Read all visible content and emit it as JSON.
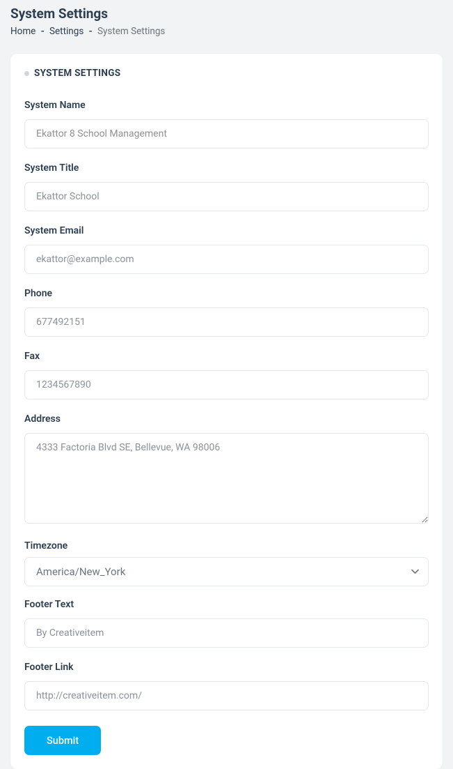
{
  "header": {
    "page_title": "System Settings",
    "breadcrumb": {
      "home": "Home",
      "settings": "Settings",
      "current": "System Settings"
    }
  },
  "card": {
    "title": "SYSTEM SETTINGS"
  },
  "form": {
    "system_name": {
      "label": "System Name",
      "value": "Ekattor 8 School Management"
    },
    "system_title": {
      "label": "System Title",
      "value": "Ekattor School"
    },
    "system_email": {
      "label": "System Email",
      "value": "ekattor@example.com"
    },
    "phone": {
      "label": "Phone",
      "value": "677492151"
    },
    "fax": {
      "label": "Fax",
      "value": "1234567890"
    },
    "address": {
      "label": "Address",
      "value": "4333 Factoria Blvd SE, Bellevue, WA 98006"
    },
    "timezone": {
      "label": "Timezone",
      "value": "America/New_York"
    },
    "footer_text": {
      "label": "Footer Text",
      "value": "By Creativeitem"
    },
    "footer_link": {
      "label": "Footer Link",
      "value": "http://creativeitem.com/"
    },
    "submit": "Submit"
  }
}
